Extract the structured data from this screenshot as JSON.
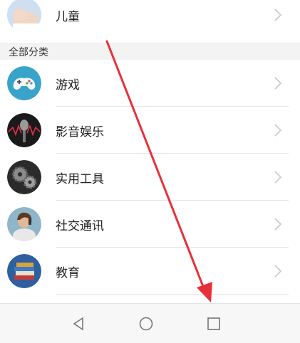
{
  "list_top": {
    "label": "儿童",
    "icon": "baby-avatar-icon"
  },
  "section": {
    "title": "全部分类"
  },
  "categories": [
    {
      "label": "游戏",
      "icon": "gamepad-icon"
    },
    {
      "label": "影音娱乐",
      "icon": "microphone-icon"
    },
    {
      "label": "实用工具",
      "icon": "gears-icon"
    },
    {
      "label": "社交通讯",
      "icon": "person-phone-icon"
    },
    {
      "label": "教育",
      "icon": "books-icon"
    }
  ],
  "navigation": {
    "back": "back-triangle-icon",
    "home": "home-circle-icon",
    "recents": "recents-square-icon"
  },
  "colors": {
    "annotation_arrow": "#e8303a",
    "section_bg": "#f3f3f3",
    "nav_bg": "#f7f7f7"
  }
}
